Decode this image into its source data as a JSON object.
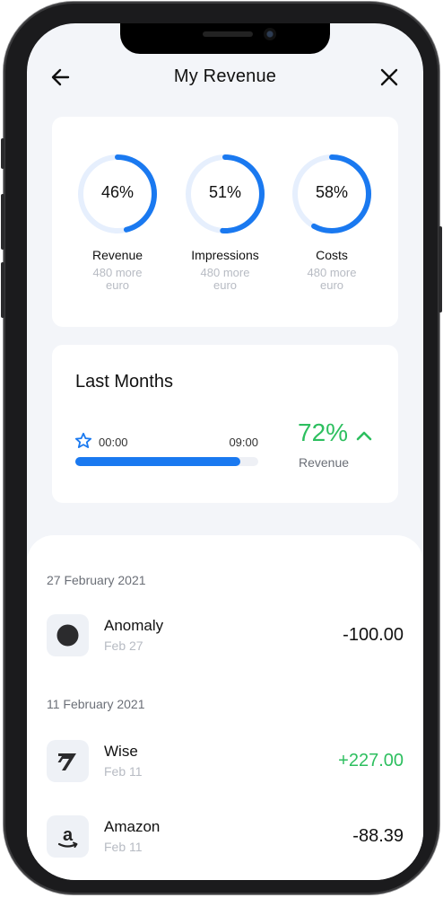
{
  "header": {
    "title": "My Revenue",
    "back_icon": "arrow-left-icon",
    "close_icon": "close-icon"
  },
  "stats": [
    {
      "percent_label": "46%",
      "percent": 46,
      "label": "Revenue",
      "sub": "480 more euro"
    },
    {
      "percent_label": "51%",
      "percent": 51,
      "label": "Impressions",
      "sub": "480 more euro"
    },
    {
      "percent_label": "58%",
      "percent": 58,
      "label": "Costs",
      "sub": "480 more euro"
    }
  ],
  "last_months": {
    "title": "Last Months",
    "time_start": "00:00",
    "time_end": "09:00",
    "progress": 0.9,
    "percent": "72%",
    "percent_label": "Revenue"
  },
  "groups": [
    {
      "date": "27 February 2021",
      "transactions": [
        {
          "name": "Anomaly",
          "date": "Feb 27",
          "amount": "-100.00",
          "icon": "anomaly-dot-icon"
        }
      ]
    },
    {
      "date": "11 February 2021",
      "transactions": [
        {
          "name": "Wise",
          "date": "Feb 11",
          "amount": "+227.00",
          "icon": "wise-logo-icon"
        },
        {
          "name": "Amazon",
          "date": "Feb 11",
          "amount": "-88.39",
          "icon": "amazon-logo-icon"
        }
      ]
    }
  ],
  "colors": {
    "accent": "#1a79f0",
    "ring_track": "#e6effd",
    "positive": "#2dbf5f",
    "screen_bg": "#f3f5f9"
  }
}
